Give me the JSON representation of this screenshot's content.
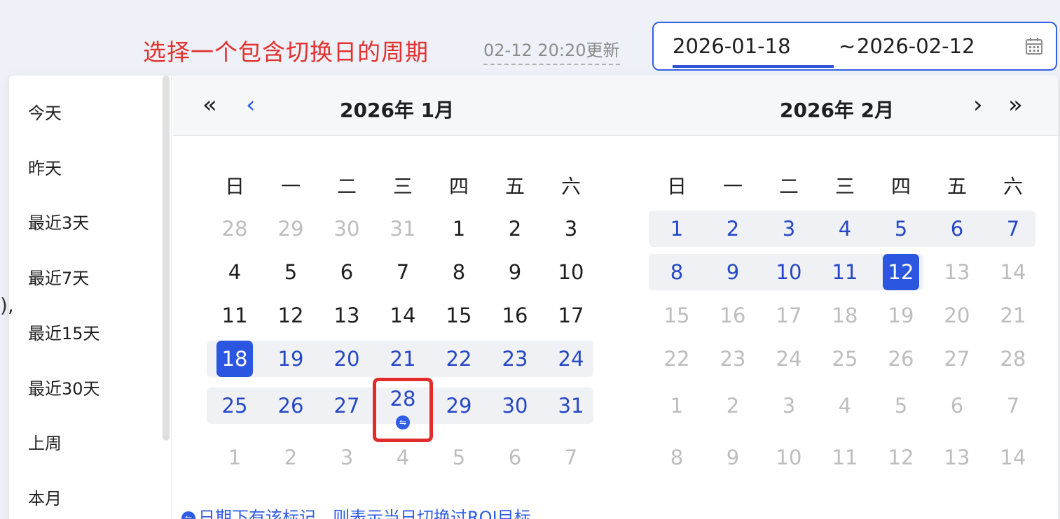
{
  "header": {
    "annotation": "选择一个包含切换日的周期",
    "update_time": "02-12 20:20更新",
    "range": {
      "start": "2026-01-18",
      "separator": "~",
      "end": "2026-02-12"
    }
  },
  "presets": [
    "今天",
    "昨天",
    "最近3天",
    "最近7天",
    "最近15天",
    "最近30天",
    "上周",
    "本月"
  ],
  "nav": {
    "prev_year": "«",
    "prev_month": "‹",
    "next_month": "›",
    "next_year": "»"
  },
  "weekdays": [
    "日",
    "一",
    "二",
    "三",
    "四",
    "五",
    "六"
  ],
  "months": [
    {
      "title": "2026年 1月",
      "weeks": [
        [
          "28",
          "29",
          "30",
          "31",
          "1",
          "2",
          "3"
        ],
        [
          "4",
          "5",
          "6",
          "7",
          "8",
          "9",
          "10"
        ],
        [
          "11",
          "12",
          "13",
          "14",
          "15",
          "16",
          "17"
        ],
        [
          "18",
          "19",
          "20",
          "21",
          "22",
          "23",
          "24"
        ],
        [
          "25",
          "26",
          "27",
          "28",
          "29",
          "30",
          "31"
        ],
        [
          "1",
          "2",
          "3",
          "4",
          "5",
          "6",
          "7"
        ]
      ],
      "other_month_rows": {
        "0": [
          0,
          1,
          2,
          3
        ],
        "5": [
          0,
          1,
          2,
          3,
          4,
          5,
          6
        ]
      },
      "range_rows": [
        3,
        4
      ],
      "selected": {
        "row": 3,
        "col": 0
      },
      "switch_day": {
        "row": 4,
        "col": 3
      }
    },
    {
      "title": "2026年 2月",
      "weeks": [
        [
          "1",
          "2",
          "3",
          "4",
          "5",
          "6",
          "7"
        ],
        [
          "8",
          "9",
          "10",
          "11",
          "12",
          "13",
          "14"
        ],
        [
          "15",
          "16",
          "17",
          "18",
          "19",
          "20",
          "21"
        ],
        [
          "22",
          "23",
          "24",
          "25",
          "26",
          "27",
          "28"
        ],
        [
          "1",
          "2",
          "3",
          "4",
          "5",
          "6",
          "7"
        ],
        [
          "8",
          "9",
          "10",
          "11",
          "12",
          "13",
          "14"
        ]
      ],
      "range_rows": [
        0,
        1
      ],
      "range_end_col": 4,
      "selected": {
        "row": 1,
        "col": 4
      }
    }
  ],
  "footnote": "日期下有该标记，则表示当日切换过ROI目标",
  "colors": {
    "accent": "#2b57e0",
    "annotation": "#e2312f",
    "range_text": "#2547c5"
  }
}
